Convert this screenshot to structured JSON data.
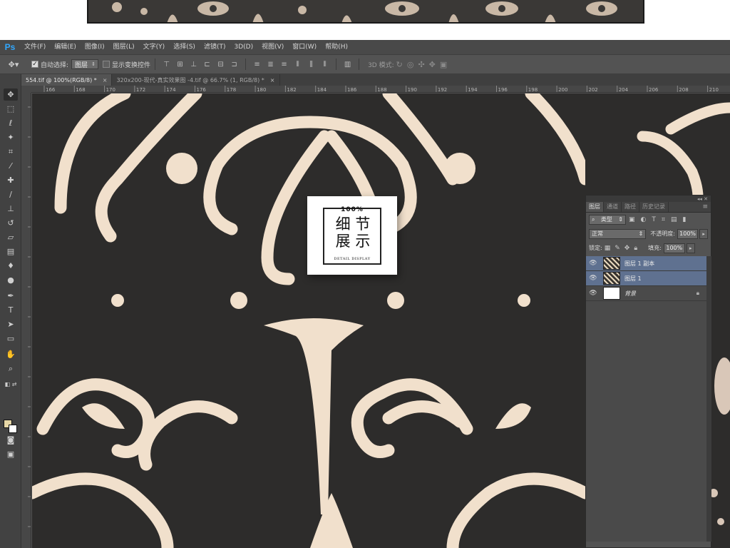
{
  "app": {
    "logo": "Ps"
  },
  "menubar": {
    "items": [
      "文件(F)",
      "编辑(E)",
      "图像(I)",
      "图层(L)",
      "文字(Y)",
      "选择(S)",
      "滤镜(T)",
      "3D(D)",
      "视图(V)",
      "窗口(W)",
      "帮助(H)"
    ]
  },
  "options": {
    "auto_select_label": "自动选择:",
    "auto_select_checked": true,
    "auto_select_target": "图层",
    "show_transform_label": "显示变换控件",
    "show_transform_checked": false,
    "mode_3d_label": "3D 模式:"
  },
  "tabs": [
    {
      "label": "554.tif @ 100%(RGB/8) *",
      "active": true
    },
    {
      "label": "320x200-现代-真实效果图 -4.tif @ 66.7% (1, RGB/8) *",
      "active": false
    }
  ],
  "ruler_top_labels": [
    "166",
    "168",
    "170",
    "172",
    "174",
    "176",
    "178",
    "180",
    "182",
    "184",
    "186",
    "188",
    "190",
    "192",
    "194",
    "196",
    "198",
    "200",
    "202",
    "204",
    "206",
    "208",
    "210"
  ],
  "toolbox": {
    "tools": [
      "move-tool",
      "marquee-tool",
      "lasso-tool",
      "magic-wand-tool",
      "crop-tool",
      "eyedropper-tool",
      "healing-brush-tool",
      "brush-tool",
      "clone-stamp-tool",
      "history-brush-tool",
      "eraser-tool",
      "gradient-tool",
      "blur-tool",
      "dodge-tool",
      "pen-tool",
      "type-tool",
      "path-selection-tool",
      "shape-tool",
      "hand-tool",
      "zoom-tool"
    ],
    "foreground_color": "#e6d7a6",
    "background_color": "#ffffff"
  },
  "badge": {
    "percent": "100%",
    "title_line1": "细 节",
    "title_line2": "展 示",
    "subtitle": "DETAIL DISPLAY"
  },
  "layers_panel": {
    "tabs": [
      "图层",
      "通道",
      "路径",
      "历史记录"
    ],
    "filter_kind": "类型",
    "blend_mode": "正常",
    "opacity_label": "不透明度:",
    "opacity_value": "100%",
    "lock_label": "锁定:",
    "fill_label": "填充:",
    "fill_value": "100%",
    "layers": [
      {
        "name": "图层 1 副本",
        "thumb": "pattern",
        "selected": true,
        "locked": false,
        "italic": false
      },
      {
        "name": "图层 1",
        "thumb": "pattern",
        "selected": true,
        "locked": false,
        "italic": false
      },
      {
        "name": "背景",
        "thumb": "white",
        "selected": false,
        "locked": true,
        "italic": true
      }
    ]
  },
  "colors": {
    "canvas_bg": "#2d2c2b",
    "ornament": "#f1e0cc",
    "ps_blue": "#31a8ff"
  }
}
